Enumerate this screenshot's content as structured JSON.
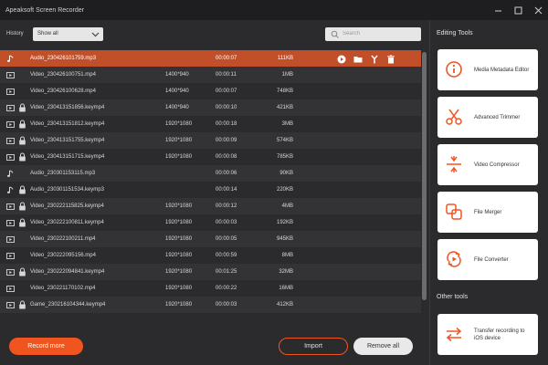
{
  "app": {
    "title": "Apeaksoft Screen Recorder"
  },
  "toolbar": {
    "history_label": "History",
    "history_value": "Show all",
    "search_placeholder": "Search"
  },
  "files": [
    {
      "type": "audio",
      "locked": false,
      "name": "Audio_230426101759.mp3",
      "resolution": "",
      "duration": "00:00:07",
      "size": "111KB",
      "selected": true
    },
    {
      "type": "video",
      "locked": false,
      "name": "Video_230426100751.mp4",
      "resolution": "1400*940",
      "duration": "00:00:11",
      "size": "1MB",
      "selected": false
    },
    {
      "type": "video",
      "locked": false,
      "name": "Video_230426100628.mp4",
      "resolution": "1400*940",
      "duration": "00:00:07",
      "size": "748KB",
      "selected": false
    },
    {
      "type": "video",
      "locked": true,
      "name": "Video_230413151856.keymp4",
      "resolution": "1400*940",
      "duration": "00:00:10",
      "size": "421KB",
      "selected": false
    },
    {
      "type": "video",
      "locked": true,
      "name": "Video_230413151812.keymp4",
      "resolution": "1920*1080",
      "duration": "00:00:18",
      "size": "3MB",
      "selected": false
    },
    {
      "type": "video",
      "locked": true,
      "name": "Video_230413151755.keymp4",
      "resolution": "1920*1080",
      "duration": "00:00:09",
      "size": "574KB",
      "selected": false
    },
    {
      "type": "video",
      "locked": true,
      "name": "Video_230413151715.keymp4",
      "resolution": "1920*1080",
      "duration": "00:00:08",
      "size": "785KB",
      "selected": false
    },
    {
      "type": "audio",
      "locked": false,
      "name": "Audio_230301153115.mp3",
      "resolution": "",
      "duration": "00:00:06",
      "size": "90KB",
      "selected": false
    },
    {
      "type": "audio",
      "locked": true,
      "name": "Audio_230301151534.keymp3",
      "resolution": "",
      "duration": "00:00:14",
      "size": "220KB",
      "selected": false
    },
    {
      "type": "video",
      "locked": true,
      "name": "Video_230222115825.keymp4",
      "resolution": "1920*1080",
      "duration": "00:00:12",
      "size": "4MB",
      "selected": false
    },
    {
      "type": "video",
      "locked": true,
      "name": "Video_230222100811.keymp4",
      "resolution": "1920*1080",
      "duration": "00:00:03",
      "size": "192KB",
      "selected": false
    },
    {
      "type": "video",
      "locked": false,
      "name": "Video_230222100211.mp4",
      "resolution": "1920*1080",
      "duration": "00:00:05",
      "size": "945KB",
      "selected": false
    },
    {
      "type": "video",
      "locked": false,
      "name": "Video_230222095156.mp4",
      "resolution": "1920*1080",
      "duration": "00:00:59",
      "size": "8MB",
      "selected": false
    },
    {
      "type": "video",
      "locked": true,
      "name": "Video_230222094841.keymp4",
      "resolution": "1920*1080",
      "duration": "00:01:25",
      "size": "32MB",
      "selected": false
    },
    {
      "type": "video",
      "locked": false,
      "name": "Video_230221170102.mp4",
      "resolution": "1920*1080",
      "duration": "00:00:22",
      "size": "16MB",
      "selected": false
    },
    {
      "type": "game",
      "locked": true,
      "name": "Game_230216104344.keymp4",
      "resolution": "1920*1080",
      "duration": "00:00:03",
      "size": "412KB",
      "selected": false
    }
  ],
  "row_actions": [
    "play-icon",
    "folder-icon",
    "edit-tools-icon",
    "trash-icon"
  ],
  "bottom": {
    "record_more": "Record more",
    "import": "Import",
    "remove_all": "Remove all"
  },
  "panel": {
    "editing_heading": "Editing Tools",
    "tools": [
      {
        "label": "Media Metadata Editor",
        "icon": "metadata-icon"
      },
      {
        "label": "Advanced Trimmer",
        "icon": "scissors-icon"
      },
      {
        "label": "Video Compressor",
        "icon": "compress-icon"
      },
      {
        "label": "File Merger",
        "icon": "merge-icon"
      },
      {
        "label": "File Converter",
        "icon": "convert-icon"
      }
    ],
    "other_heading": "Other tools",
    "other_tools": [
      {
        "label": "Transfer recording to iOS device",
        "icon": "transfer-icon"
      }
    ]
  },
  "colors": {
    "accent": "#F0551F",
    "selected_row": "#C1502A",
    "background": "#2B2B2D",
    "titlebar": "#1E1E20"
  }
}
